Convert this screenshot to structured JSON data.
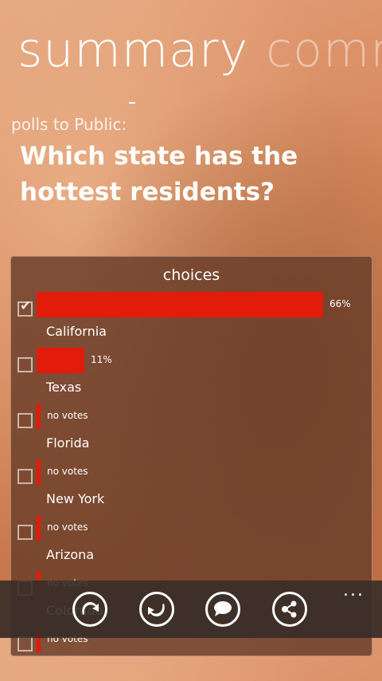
{
  "pivot": {
    "active": "summary",
    "next": "comments"
  },
  "subtitle": "polls to Public:",
  "question": "Which state has the hottest residents?",
  "panel": {
    "title": "choices"
  },
  "choices": [
    {
      "name": "California",
      "result": "66%",
      "percent": 66,
      "checked": true
    },
    {
      "name": "Texas",
      "result": "11%",
      "percent": 11,
      "checked": false
    },
    {
      "name": "Florida",
      "result": "no votes",
      "percent": 0,
      "checked": false
    },
    {
      "name": "New York",
      "result": "no votes",
      "percent": 0,
      "checked": false
    },
    {
      "name": "Arizona",
      "result": "no votes",
      "percent": 0,
      "checked": false
    },
    {
      "name": "Colorado",
      "result": "no votes",
      "percent": 0,
      "checked": false
    },
    {
      "name": "",
      "result": "no votes",
      "percent": 0,
      "checked": false
    }
  ],
  "appbar": {
    "icons": [
      "thumbs-up-icon",
      "thumbs-down-icon",
      "comment-icon",
      "share-icon"
    ],
    "more": "..."
  },
  "colors": {
    "bar": "#e31b0b",
    "panel": "#693c28",
    "appbar": "#372d28"
  }
}
